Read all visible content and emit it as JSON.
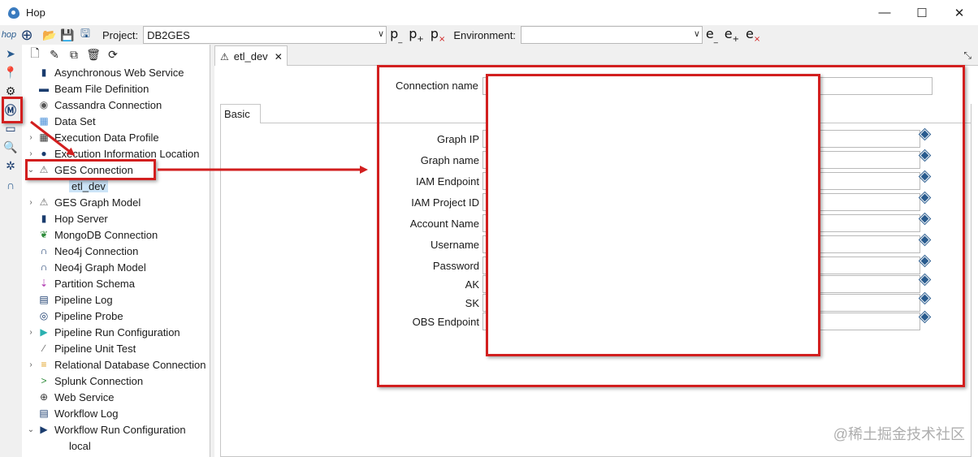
{
  "window": {
    "title": "Hop",
    "minimize": "—",
    "maximize": "☐",
    "close": "✕"
  },
  "toolbar": {
    "project_label": "Project:",
    "project_value": "DB2GES",
    "environment_label": "Environment:",
    "environment_value": "",
    "p_minus": "p",
    "p_plus": "p",
    "p_del": "p",
    "e_minus": "e",
    "e_plus": "e",
    "e_del": "e"
  },
  "tree": {
    "items": [
      {
        "label": "Asynchronous Web Service",
        "icon": "web-service-icon",
        "expand": ""
      },
      {
        "label": "Beam File Definition",
        "icon": "folder-icon",
        "expand": ""
      },
      {
        "label": "Cassandra Connection",
        "icon": "cassandra-icon",
        "expand": ""
      },
      {
        "label": "Data Set",
        "icon": "data-set-icon",
        "expand": ""
      },
      {
        "label": "Execution Data Profile",
        "icon": "table-icon",
        "expand": ">"
      },
      {
        "label": "Execution Information Location",
        "icon": "location-icon",
        "expand": ">"
      },
      {
        "label": "GES Connection",
        "icon": "ges-icon",
        "expand": "v"
      },
      {
        "label": "GES Graph Model",
        "icon": "ges-icon",
        "expand": ">"
      },
      {
        "label": "Hop Server",
        "icon": "server-icon",
        "expand": ""
      },
      {
        "label": "MongoDB Connection",
        "icon": "mongodb-icon",
        "expand": ""
      },
      {
        "label": "Neo4j Connection",
        "icon": "neo4j-icon",
        "expand": ""
      },
      {
        "label": "Neo4j Graph Model",
        "icon": "neo4j-icon",
        "expand": ""
      },
      {
        "label": "Partition Schema",
        "icon": "partition-icon",
        "expand": ""
      },
      {
        "label": "Pipeline Log",
        "icon": "pipeline-log-icon",
        "expand": ""
      },
      {
        "label": "Pipeline Probe",
        "icon": "probe-icon",
        "expand": ""
      },
      {
        "label": "Pipeline Run Configuration",
        "icon": "pipeline-run-icon",
        "expand": ">"
      },
      {
        "label": "Pipeline Unit Test",
        "icon": "test-icon",
        "expand": ""
      },
      {
        "label": "Relational Database Connection",
        "icon": "database-icon",
        "expand": ">"
      },
      {
        "label": "Splunk Connection",
        "icon": "splunk-icon",
        "expand": ""
      },
      {
        "label": "Web Service",
        "icon": "globe-icon",
        "expand": ""
      },
      {
        "label": "Workflow Log",
        "icon": "workflow-log-icon",
        "expand": ""
      },
      {
        "label": "Workflow Run Configuration",
        "icon": "workflow-run-icon",
        "expand": "v"
      }
    ],
    "ges_child": "etl_dev",
    "workflow_child": "local"
  },
  "editor": {
    "tab_label": "etl_dev",
    "connection_name_label": "Connection name",
    "basic_tab": "Basic",
    "fields": [
      {
        "label": "Graph IP"
      },
      {
        "label": "Graph name"
      },
      {
        "label": "IAM Endpoint"
      },
      {
        "label": "IAM Project ID"
      },
      {
        "label": "Account Name"
      },
      {
        "label": "Username"
      },
      {
        "label": "Password"
      },
      {
        "label": "AK"
      },
      {
        "label": "SK"
      },
      {
        "label": "OBS Endpoint"
      }
    ]
  },
  "watermark": "@稀土掘金技术社区",
  "colors": {
    "annotation": "#d21f1f",
    "selection": "#cce4f7",
    "accent": "#2a5c8f"
  }
}
